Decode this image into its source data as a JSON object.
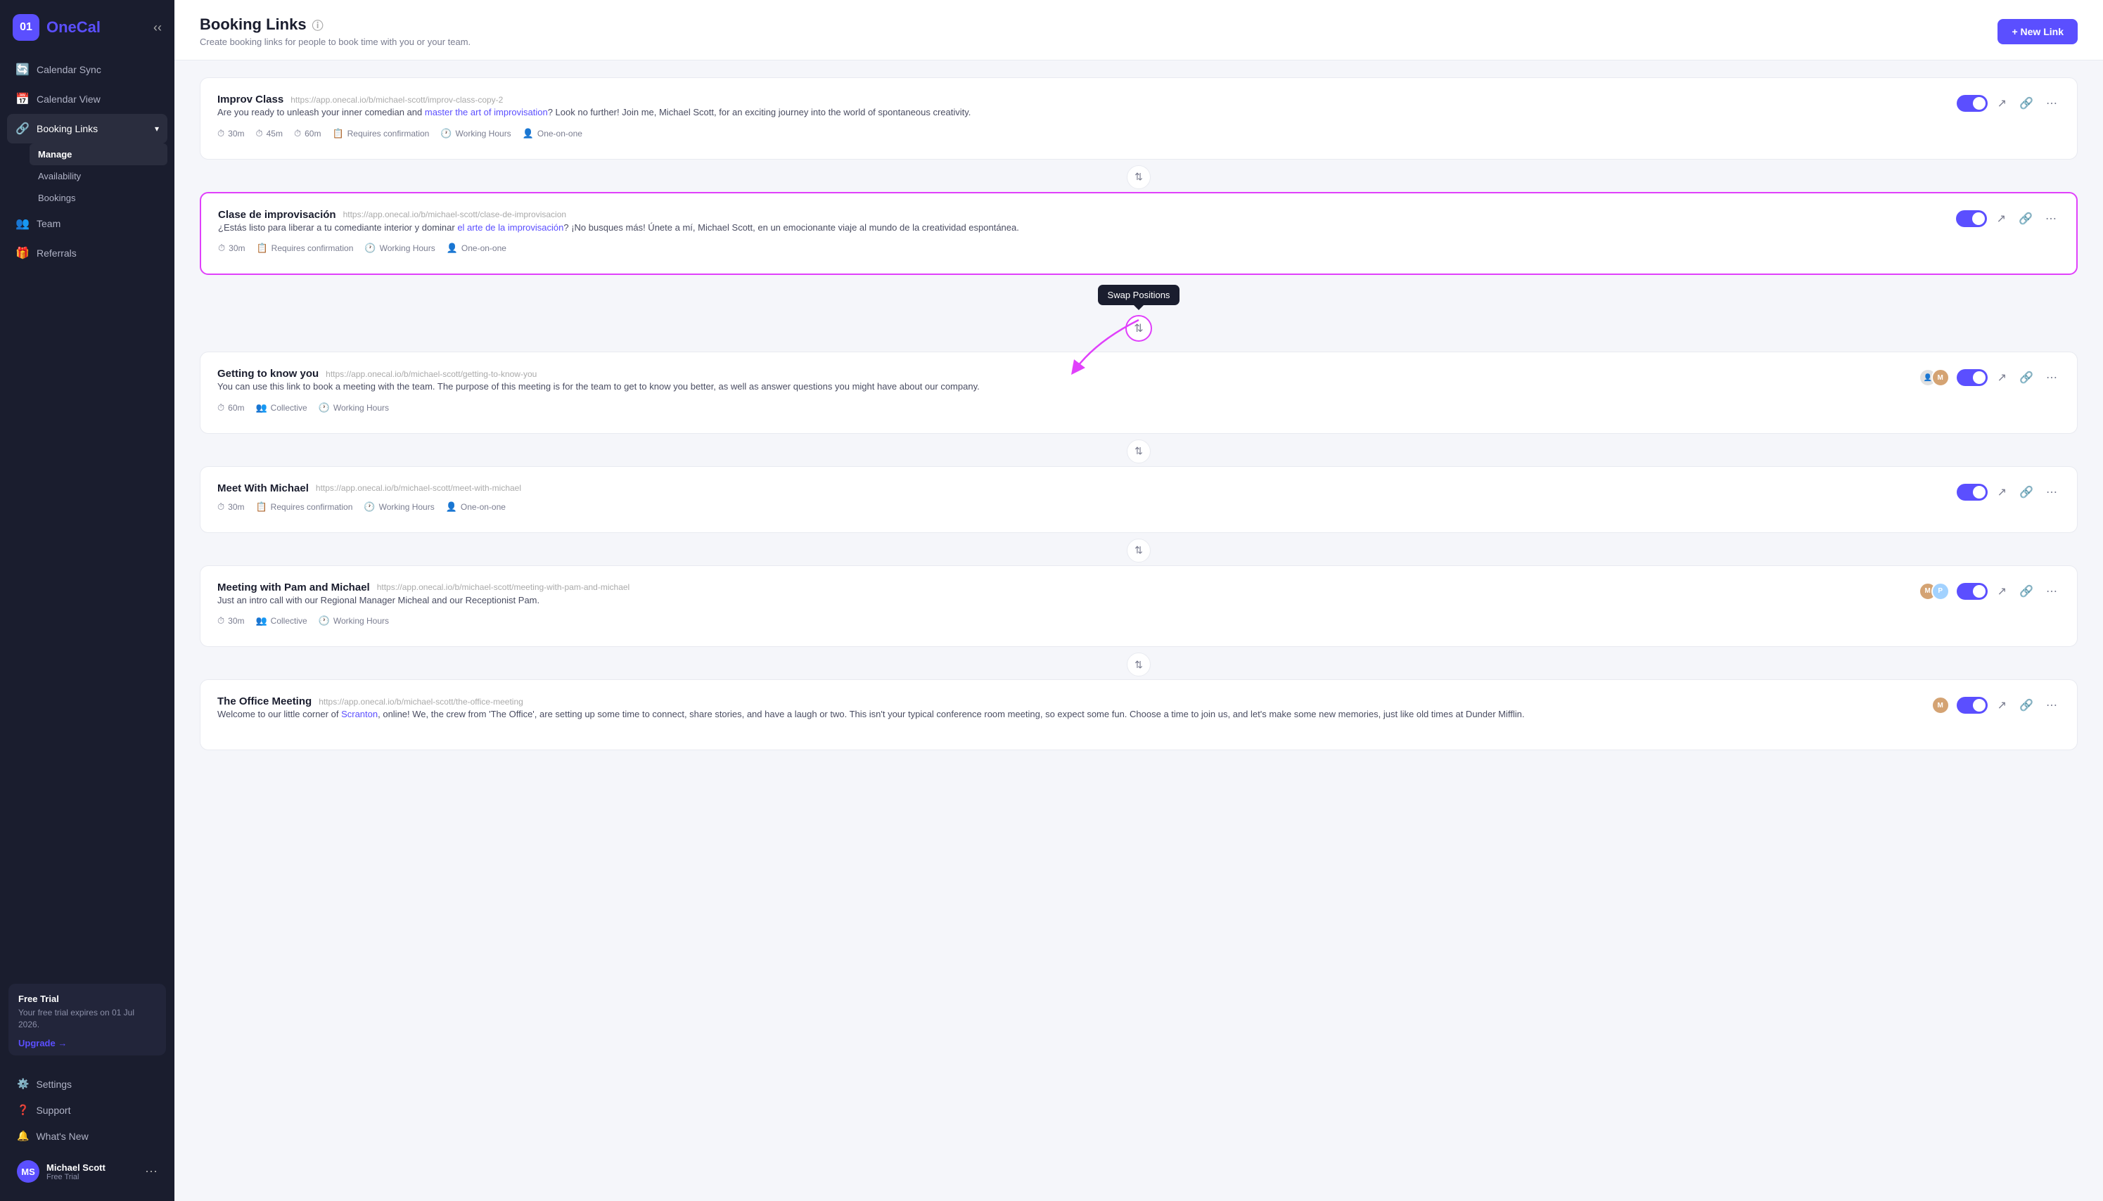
{
  "app": {
    "logo_number": "01",
    "logo_name_part1": "One",
    "logo_name_part2": "Cal"
  },
  "sidebar": {
    "nav_items": [
      {
        "id": "calendar-sync",
        "label": "Calendar Sync",
        "icon": "🔄"
      },
      {
        "id": "calendar-view",
        "label": "Calendar View",
        "icon": "📅"
      },
      {
        "id": "booking-links",
        "label": "Booking Links",
        "icon": "🔗",
        "has_chevron": true
      },
      {
        "id": "team",
        "label": "Team",
        "icon": "👥"
      },
      {
        "id": "referrals",
        "label": "Referrals",
        "icon": "🎁"
      }
    ],
    "sub_items": [
      {
        "id": "manage",
        "label": "Manage",
        "active": true
      },
      {
        "id": "availability",
        "label": "Availability"
      },
      {
        "id": "bookings",
        "label": "Bookings"
      }
    ],
    "bottom_items": [
      {
        "id": "settings",
        "label": "Settings",
        "icon": "⚙️"
      },
      {
        "id": "support",
        "label": "Support",
        "icon": "❓"
      },
      {
        "id": "whats-new",
        "label": "What's New",
        "icon": "🔔"
      }
    ],
    "trial": {
      "title": "Free Trial",
      "desc": "Your free trial expires on 01 Jul 2026.",
      "upgrade_label": "Upgrade →"
    },
    "user": {
      "name": "Michael Scott",
      "sub": "Free Trial",
      "initials": "MS"
    }
  },
  "header": {
    "title": "Booking Links",
    "subtitle": "Create booking links for people to book time with you or your team.",
    "new_link_label": "+ New Link"
  },
  "bookings": [
    {
      "id": "improv-class",
      "name": "Improv Class",
      "url": "https://app.onecal.io/b/michael-scott/improv-class-copy-2",
      "desc_plain": "Are you ready to unleash your inner comedian and ",
      "desc_link": "master the art of improvisation",
      "desc_end": "? Look no further! Join me, Michael Scott, for an exciting journey into the world of spontaneous creativity.",
      "tags": [
        {
          "icon": "⏱",
          "label": "30m"
        },
        {
          "icon": "⏱",
          "label": "45m"
        },
        {
          "icon": "⏱",
          "label": "60m"
        },
        {
          "icon": "📋",
          "label": "Requires confirmation"
        },
        {
          "icon": "🕐",
          "label": "Working Hours"
        },
        {
          "icon": "👤",
          "label": "One-on-one"
        }
      ],
      "enabled": true,
      "has_avatars": false
    },
    {
      "id": "clase-improvisacion",
      "name": "Clase de improvisación",
      "url": "https://app.onecal.io/b/michael-scott/clase-de-improvisacion",
      "desc_plain": "¿Estás listo para liberar a tu comediante interior y dominar ",
      "desc_link": "el arte de la improvisación",
      "desc_end": "? ¡No busques más! Únete a mí, Michael Scott, en un emocionante viaje al mundo de la creatividad espontánea.",
      "tags": [
        {
          "icon": "⏱",
          "label": "30m"
        },
        {
          "icon": "📋",
          "label": "Requires confirmation"
        },
        {
          "icon": "🕐",
          "label": "Working Hours"
        },
        {
          "icon": "👤",
          "label": "One-on-one"
        }
      ],
      "enabled": true,
      "has_avatars": false,
      "swap_highlighted": true
    },
    {
      "id": "getting-to-know-you",
      "name": "Getting to know you",
      "url": "https://app.onecal.io/b/michael-scott/getting-to-know-you",
      "desc_plain": "You can use this link to book a meeting with the team. The purpose of this meeting is for the team to get to know you better, as well as answer questions you might have about our company.",
      "desc_link": "",
      "desc_end": "",
      "tags": [
        {
          "icon": "⏱",
          "label": "60m"
        },
        {
          "icon": "👥",
          "label": "Collective"
        },
        {
          "icon": "🕐",
          "label": "Working Hours"
        }
      ],
      "enabled": true,
      "has_avatars": true,
      "avatars": [
        "MS",
        "PA"
      ]
    },
    {
      "id": "meet-with-michael",
      "name": "Meet With Michael",
      "url": "https://app.onecal.io/b/michael-scott/meet-with-michael",
      "desc_plain": "",
      "desc_link": "",
      "desc_end": "",
      "tags": [
        {
          "icon": "⏱",
          "label": "30m"
        },
        {
          "icon": "📋",
          "label": "Requires confirmation"
        },
        {
          "icon": "🕐",
          "label": "Working Hours"
        },
        {
          "icon": "👤",
          "label": "One-on-one"
        }
      ],
      "enabled": true,
      "has_avatars": false
    },
    {
      "id": "meeting-with-pam-michael",
      "name": "Meeting with Pam and Michael",
      "url": "https://app.onecal.io/b/michael-scott/meeting-with-pam-and-michael",
      "desc_plain": "Just an intro call with our Regional Manager Micheal and our Receptionist Pam.",
      "desc_link": "",
      "desc_end": "",
      "tags": [
        {
          "icon": "⏱",
          "label": "30m"
        },
        {
          "icon": "👥",
          "label": "Collective"
        },
        {
          "icon": "🕐",
          "label": "Working Hours"
        }
      ],
      "enabled": true,
      "has_avatars": true,
      "avatars": [
        "MS",
        "PA"
      ]
    },
    {
      "id": "the-office-meeting",
      "name": "The Office Meeting",
      "url": "https://app.onecal.io/b/michael-scott/the-office-meeting",
      "desc_scranton": "Scranton",
      "desc_plain": "Welcome to our little corner of ",
      "desc_end": ", online! We, the crew from 'The Office', are setting up some time to connect, share stories, and have a laugh or two. This isn't your typical conference room meeting, so expect some fun. Choose a time to join us, and let's make some new memories, just like old times at Dunder Mifflin.",
      "tags": [],
      "enabled": true,
      "has_avatars": true,
      "avatars": [
        "MS"
      ]
    }
  ],
  "tooltip": {
    "swap_label": "Swap Positions"
  }
}
